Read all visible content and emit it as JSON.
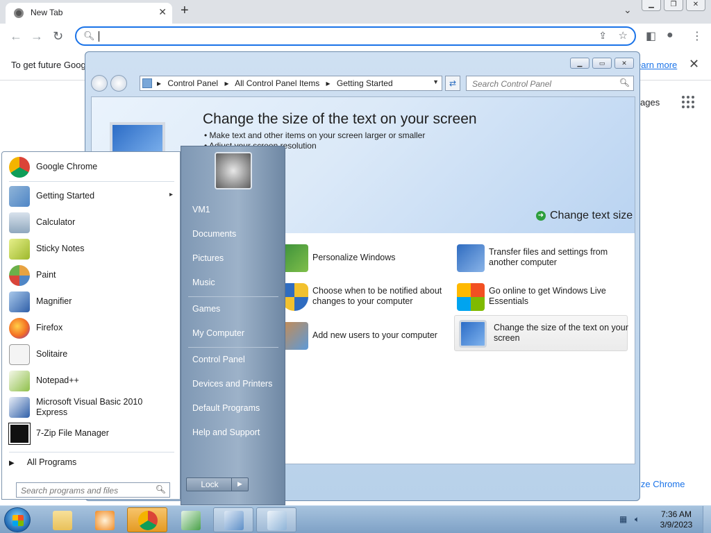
{
  "browser": {
    "tab_title": "New Tab",
    "omnibox_value": "",
    "infobar_text": "To get future Goog",
    "infobar_link": "earn more",
    "ntp_pages_label": "ages",
    "customize_label": "ize Chrome"
  },
  "control_panel": {
    "breadcrumbs": [
      "Control Panel",
      "All Control Panel Items",
      "Getting Started"
    ],
    "search_placeholder": "Search Control Panel",
    "banner": {
      "title": "Change the size of the text on your screen",
      "bullet1": "• Make text and other items on your screen larger or smaller",
      "bullet2": "• Adjust your screen resolution",
      "action": "Change text size"
    },
    "items": [
      {
        "label": "Personalize Windows",
        "icon": "personalize-icon"
      },
      {
        "label": "Transfer files and settings from another computer",
        "icon": "transfer-icon"
      },
      {
        "label": "Choose when to be notified about changes to your computer",
        "icon": "shield-icon"
      },
      {
        "label": "Go online to get Windows Live Essentials",
        "icon": "windows-flag-icon"
      },
      {
        "label": "Add new users to your computer",
        "icon": "users-icon"
      },
      {
        "label": "Change the size of the text on your screen",
        "icon": "monitor-icon"
      }
    ]
  },
  "start_menu": {
    "programs": [
      {
        "label": "Google Chrome",
        "icon": "chrome-icon",
        "color": "#db4437"
      },
      {
        "label": "Getting Started",
        "icon": "getting-started-icon",
        "color": "#6aa0d8",
        "has_submenu": true
      },
      {
        "label": "Calculator",
        "icon": "calculator-icon",
        "color": "#8fa7be"
      },
      {
        "label": "Sticky Notes",
        "icon": "sticky-notes-icon",
        "color": "#c9d84a"
      },
      {
        "label": "Paint",
        "icon": "paint-icon",
        "color": "#e7a342"
      },
      {
        "label": "Magnifier",
        "icon": "magnifier-icon",
        "color": "#4f86c6"
      },
      {
        "label": "Firefox",
        "icon": "firefox-icon",
        "color": "#f36f24"
      },
      {
        "label": "Solitaire",
        "icon": "solitaire-icon",
        "color": "#d8d8d8"
      },
      {
        "label": "Notepad++",
        "icon": "notepadpp-icon",
        "color": "#8fc04a"
      },
      {
        "label": "Microsoft Visual Basic 2010 Express",
        "icon": "visual-basic-icon",
        "color": "#2f5fa8"
      },
      {
        "label": "7-Zip File Manager",
        "icon": "7zip-icon",
        "color": "#111111"
      }
    ],
    "submenu_arrow": "▸",
    "all_programs": "All Programs",
    "search_placeholder": "Search programs and files",
    "right_links": [
      "VM1",
      "Documents",
      "Pictures",
      "Music",
      "Games",
      "My Computer",
      "Control Panel",
      "Devices and Printers",
      "Default Programs",
      "Help and Support"
    ],
    "lock_label": "Lock"
  },
  "taskbar": {
    "time": "7:36 AM",
    "date": "3/9/2023",
    "apps": [
      {
        "name": "explorer-taskbar-button",
        "icon": "folder-icon",
        "color": "#e9c15a",
        "state": "pinned"
      },
      {
        "name": "media-player-taskbar-button",
        "icon": "media-player-icon",
        "color": "#f08a24",
        "state": "pinned"
      },
      {
        "name": "chrome-taskbar-button",
        "icon": "chrome-icon",
        "color": "#db4437",
        "state": "active"
      },
      {
        "name": "csharp-taskbar-button",
        "icon": "csharp-icon",
        "color": "#4aa24a",
        "state": "pinned"
      },
      {
        "name": "control-panel-taskbar-button",
        "icon": "control-panel-icon",
        "color": "#5d8fc8",
        "state": "open"
      },
      {
        "name": "getting-started-taskbar-button",
        "icon": "getting-started-icon",
        "color": "#8fb4d8",
        "state": "open"
      }
    ]
  }
}
